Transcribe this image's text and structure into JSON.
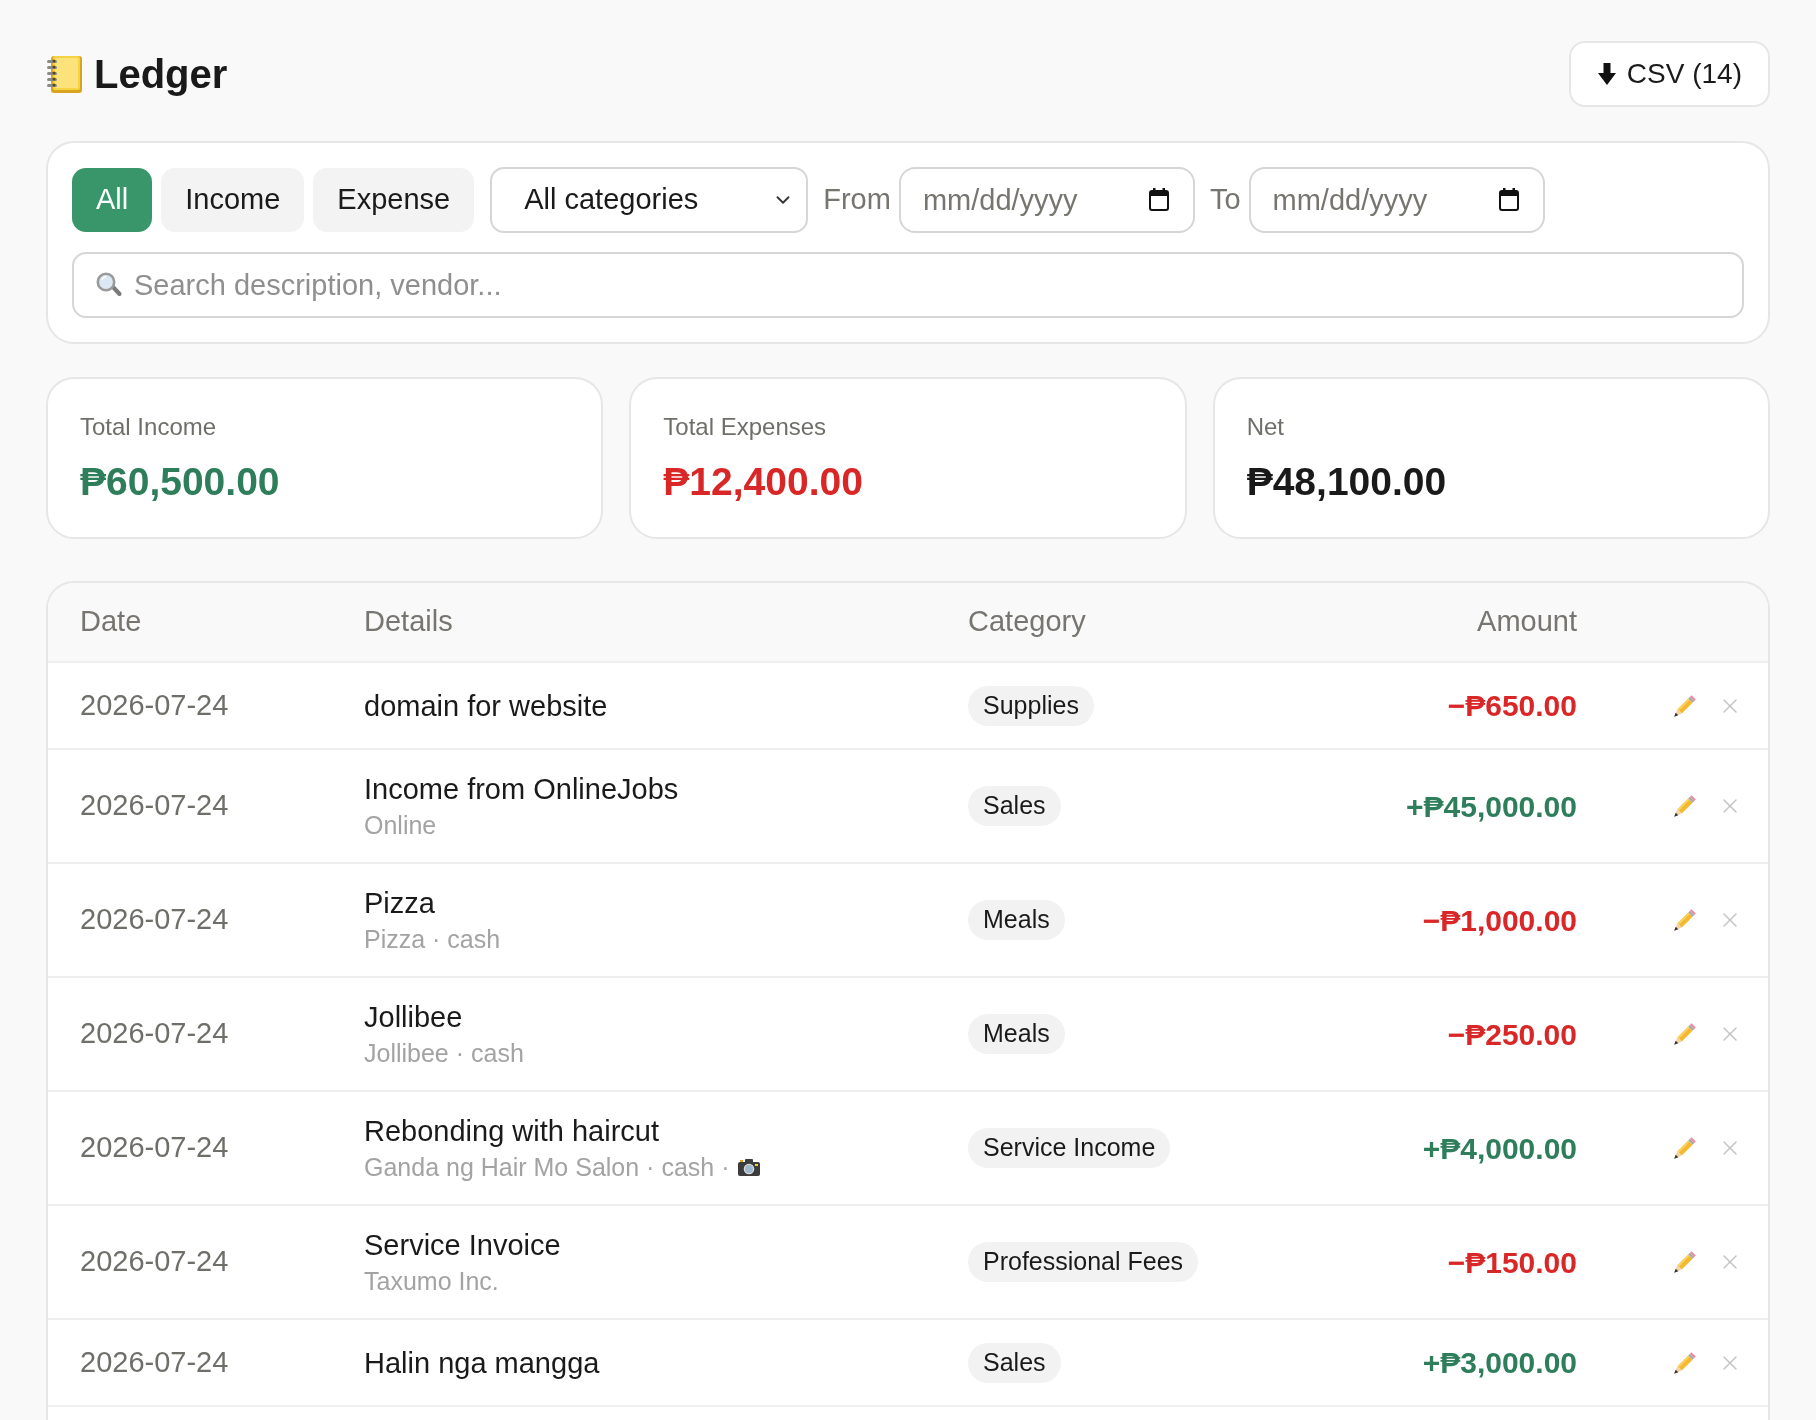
{
  "header": {
    "title": "Ledger",
    "export_button": "CSV (14)"
  },
  "filters": {
    "type_tabs": [
      {
        "label": "All",
        "selected": true
      },
      {
        "label": "Income",
        "selected": false
      },
      {
        "label": "Expense",
        "selected": false
      }
    ],
    "category_select": {
      "value": "All categories"
    },
    "date_from": {
      "label": "From",
      "placeholder": "mm/dd/yyyy"
    },
    "date_to": {
      "label": "To",
      "placeholder": "mm/dd/yyyy"
    },
    "search": {
      "placeholder": "Search description, vendor..."
    }
  },
  "summary": [
    {
      "label": "Total Income",
      "value": "₱60,500.00",
      "kind": "income"
    },
    {
      "label": "Total Expenses",
      "value": "₱12,400.00",
      "kind": "expense"
    },
    {
      "label": "Net",
      "value": "₱48,100.00",
      "kind": "net"
    }
  ],
  "table": {
    "columns": [
      "Date",
      "Details",
      "Category",
      "Amount"
    ],
    "rows": [
      {
        "date": "2026-07-24",
        "description": "domain for website",
        "category": "Supplies",
        "amount": "−₱650.00",
        "kind": "expense",
        "has_photo": false
      },
      {
        "date": "2026-07-24",
        "description": "Income from OnlineJobs",
        "meta": "Online",
        "category": "Sales",
        "amount": "+₱45,000.00",
        "kind": "income",
        "has_photo": false
      },
      {
        "date": "2026-07-24",
        "description": "Pizza",
        "meta": "Pizza · cash",
        "category": "Meals",
        "amount": "−₱1,000.00",
        "kind": "expense",
        "has_photo": false
      },
      {
        "date": "2026-07-24",
        "description": "Jollibee",
        "meta": "Jollibee · cash",
        "category": "Meals",
        "amount": "−₱250.00",
        "kind": "expense",
        "has_photo": false
      },
      {
        "date": "2026-07-24",
        "description": "Rebonding with haircut",
        "meta": "Ganda ng Hair Mo Salon · cash ·",
        "category": "Service Income",
        "amount": "+₱4,000.00",
        "kind": "income",
        "has_photo": true
      },
      {
        "date": "2026-07-24",
        "description": "Service Invoice",
        "meta": "Taxumo Inc.",
        "category": "Professional Fees",
        "amount": "−₱150.00",
        "kind": "expense",
        "has_photo": false
      },
      {
        "date": "2026-07-24",
        "description": "Halin nga mangga",
        "category": "Sales",
        "amount": "+₱3,000.00",
        "kind": "income",
        "has_photo": false
      }
    ]
  }
}
